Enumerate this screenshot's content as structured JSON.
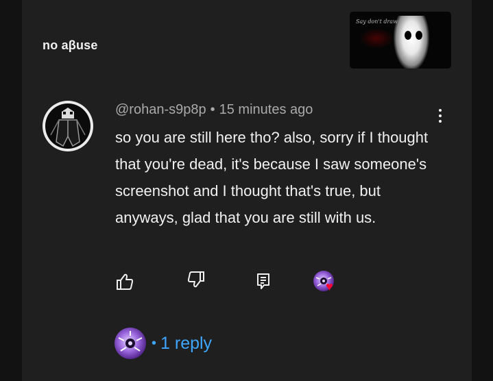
{
  "post": {
    "caption": "no aβuse",
    "thumbnail_scribble": "Say don't draw"
  },
  "comment": {
    "author": "@rohan-s9p8p",
    "separator": "•",
    "timestamp": "15 minutes ago",
    "text": "so you are still here tho? also, sorry if I thought that you're dead, it's because I saw someone's screenshot and I thought that's true, but anyways, glad that you are still with us.",
    "more_icon": "vertical-ellipsis-icon"
  },
  "actions": {
    "like_icon": "thumbs-up-icon",
    "dislike_icon": "thumbs-down-icon",
    "reply_icon": "reply-comment-icon",
    "hearted_icon": "creator-heart-icon"
  },
  "replies": {
    "separator": "•",
    "label": "1 reply"
  },
  "colors": {
    "background": "#121212",
    "panel": "#1f1f1f",
    "text_primary": "#f1f1f1",
    "text_secondary": "#aaaaaa",
    "link": "#3ea6ff",
    "heart": "#ff0033"
  }
}
